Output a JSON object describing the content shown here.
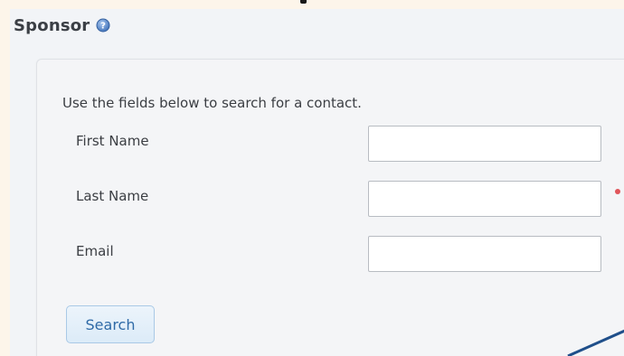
{
  "section": {
    "title": "Sponsor",
    "help_icon": "help-icon"
  },
  "form": {
    "instructions": "Use the fields below to search for a contact.",
    "fields": [
      {
        "label": "First Name",
        "value": "",
        "required": false
      },
      {
        "label": "Last Name",
        "value": "",
        "required": true
      },
      {
        "label": "Email",
        "value": "",
        "required": false
      }
    ],
    "search_label": "Search"
  },
  "colors": {
    "page_background": "#fdf5ea",
    "panel_background": "#f2f4f7",
    "button_text": "#2f6aa7",
    "required_indicator": "#e0555a",
    "overlay_line": "#1f4f8a"
  }
}
